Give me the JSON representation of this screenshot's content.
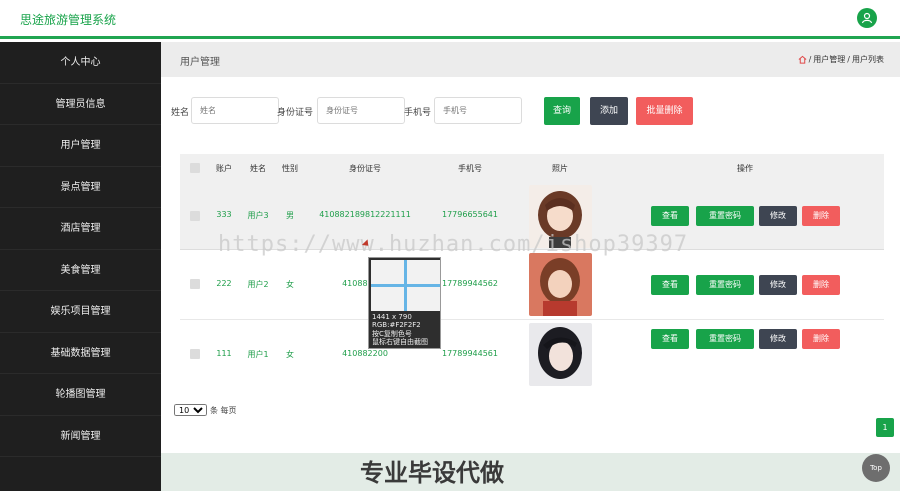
{
  "app": {
    "title": "思途旅游管理系统"
  },
  "sidebar": {
    "items": [
      {
        "label": "个人中心"
      },
      {
        "label": "管理员信息"
      },
      {
        "label": "用户管理"
      },
      {
        "label": "景点管理"
      },
      {
        "label": "酒店管理"
      },
      {
        "label": "美食管理"
      },
      {
        "label": "娱乐项目管理"
      },
      {
        "label": "基础数据管理"
      },
      {
        "label": "轮播图管理"
      },
      {
        "label": "新闻管理"
      }
    ]
  },
  "page": {
    "title": "用户管理",
    "breadcrumb": [
      "用户管理",
      "用户列表"
    ]
  },
  "search": {
    "name_label": "姓名",
    "name_placeholder": "姓名",
    "id_label": "身份证号",
    "id_placeholder": "身份证号",
    "phone_label": "手机号",
    "phone_placeholder": "手机号",
    "query": "查询",
    "add": "添加",
    "batch_delete": "批量删除"
  },
  "table": {
    "headers": [
      "账户",
      "姓名",
      "性别",
      "身份证号",
      "手机号",
      "照片",
      "操作"
    ],
    "rows": [
      {
        "account": "333",
        "name": "用户3",
        "gender": "男",
        "id": "410882189812221111",
        "phone": "17796655641"
      },
      {
        "account": "222",
        "name": "用户2",
        "gender": "女",
        "id": "410882200",
        "phone": "17789944562"
      },
      {
        "account": "111",
        "name": "用户1",
        "gender": "女",
        "id": "410882200",
        "phone": "17789944561"
      }
    ],
    "actions": {
      "view": "查看",
      "reset": "重置密码",
      "edit": "修改",
      "delete": "删除"
    }
  },
  "pagination": {
    "page_size": "10",
    "suffix": "条 每页",
    "current_page": "1"
  },
  "overlay": {
    "size": "1441 x 790",
    "rgb": "RGB:#F2F2F2",
    "hint1": "按C复制色号",
    "hint2": "鼠标右键自由截图",
    "watermark": "https://www.huzhan.com/ishop39397",
    "banner": "专业毕设代做",
    "top": "Top"
  },
  "colors": {
    "accent": "#18a34a",
    "danger": "#f25d5d",
    "dark": "#3e4552",
    "sidebar": "#1f1f1f"
  }
}
